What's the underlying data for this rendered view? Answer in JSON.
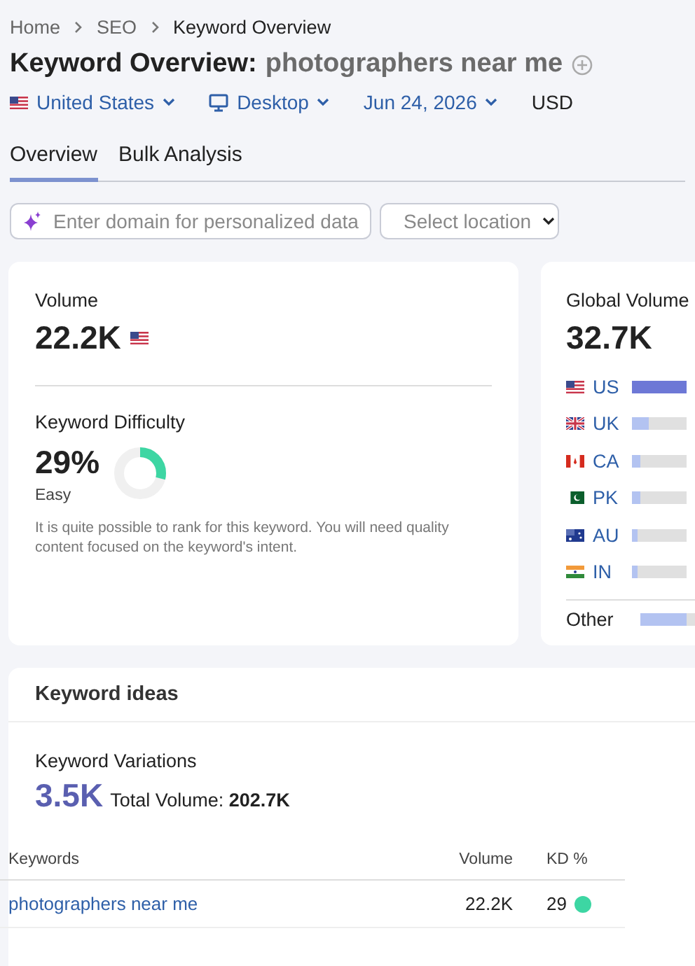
{
  "breadcrumb": [
    "Home",
    "SEO",
    "Keyword Overview"
  ],
  "title": {
    "label": "Keyword Overview:",
    "keyword": "photographers near me"
  },
  "filters": {
    "country": "United States",
    "device": "Desktop",
    "date": "Jun 24, 2026",
    "currency": "USD"
  },
  "tabs": [
    {
      "label": "Overview",
      "selected": true
    },
    {
      "label": "Bulk Analysis",
      "selected": false
    }
  ],
  "domain_field": {
    "placeholder": "Enter domain for personalized data"
  },
  "location_select": {
    "placeholder": "Select location"
  },
  "volume": {
    "label": "Volume",
    "value": "22.2K"
  },
  "difficulty": {
    "label": "Keyword Difficulty",
    "value": "29%",
    "level": 0.29,
    "rating": "Easy",
    "color": "#3dd6a3",
    "description": "It is quite possible to rank for this keyword. You will need quality content focused on the keyword's intent."
  },
  "global_volume": {
    "label": "Global Volume",
    "value": "32.7K",
    "countries": [
      {
        "code": "US",
        "kind": "us",
        "level": 1
      },
      {
        "code": "UK",
        "kind": "uk",
        "level": 0.3
      },
      {
        "code": "CA",
        "kind": "ca",
        "level": 0.15
      },
      {
        "code": "PK",
        "kind": "pk",
        "level": 0.15
      },
      {
        "code": "AU",
        "kind": "au",
        "level": 0.1
      },
      {
        "code": "IN",
        "kind": "in",
        "level": 0.1
      }
    ],
    "other": {
      "label": "Other",
      "level": 0.85
    }
  },
  "keyword_ideas": {
    "title": "Keyword ideas",
    "section": "Keyword Variations",
    "count": "3.5K",
    "total_label": "Total Volume:",
    "total_value": "202.7K",
    "columns": [
      "Keywords",
      "Volume",
      "KD %"
    ],
    "rows": [
      {
        "keyword": "photographers near me",
        "volume": "22.2K",
        "kd": "29",
        "color": "#3dd6a3"
      }
    ]
  }
}
